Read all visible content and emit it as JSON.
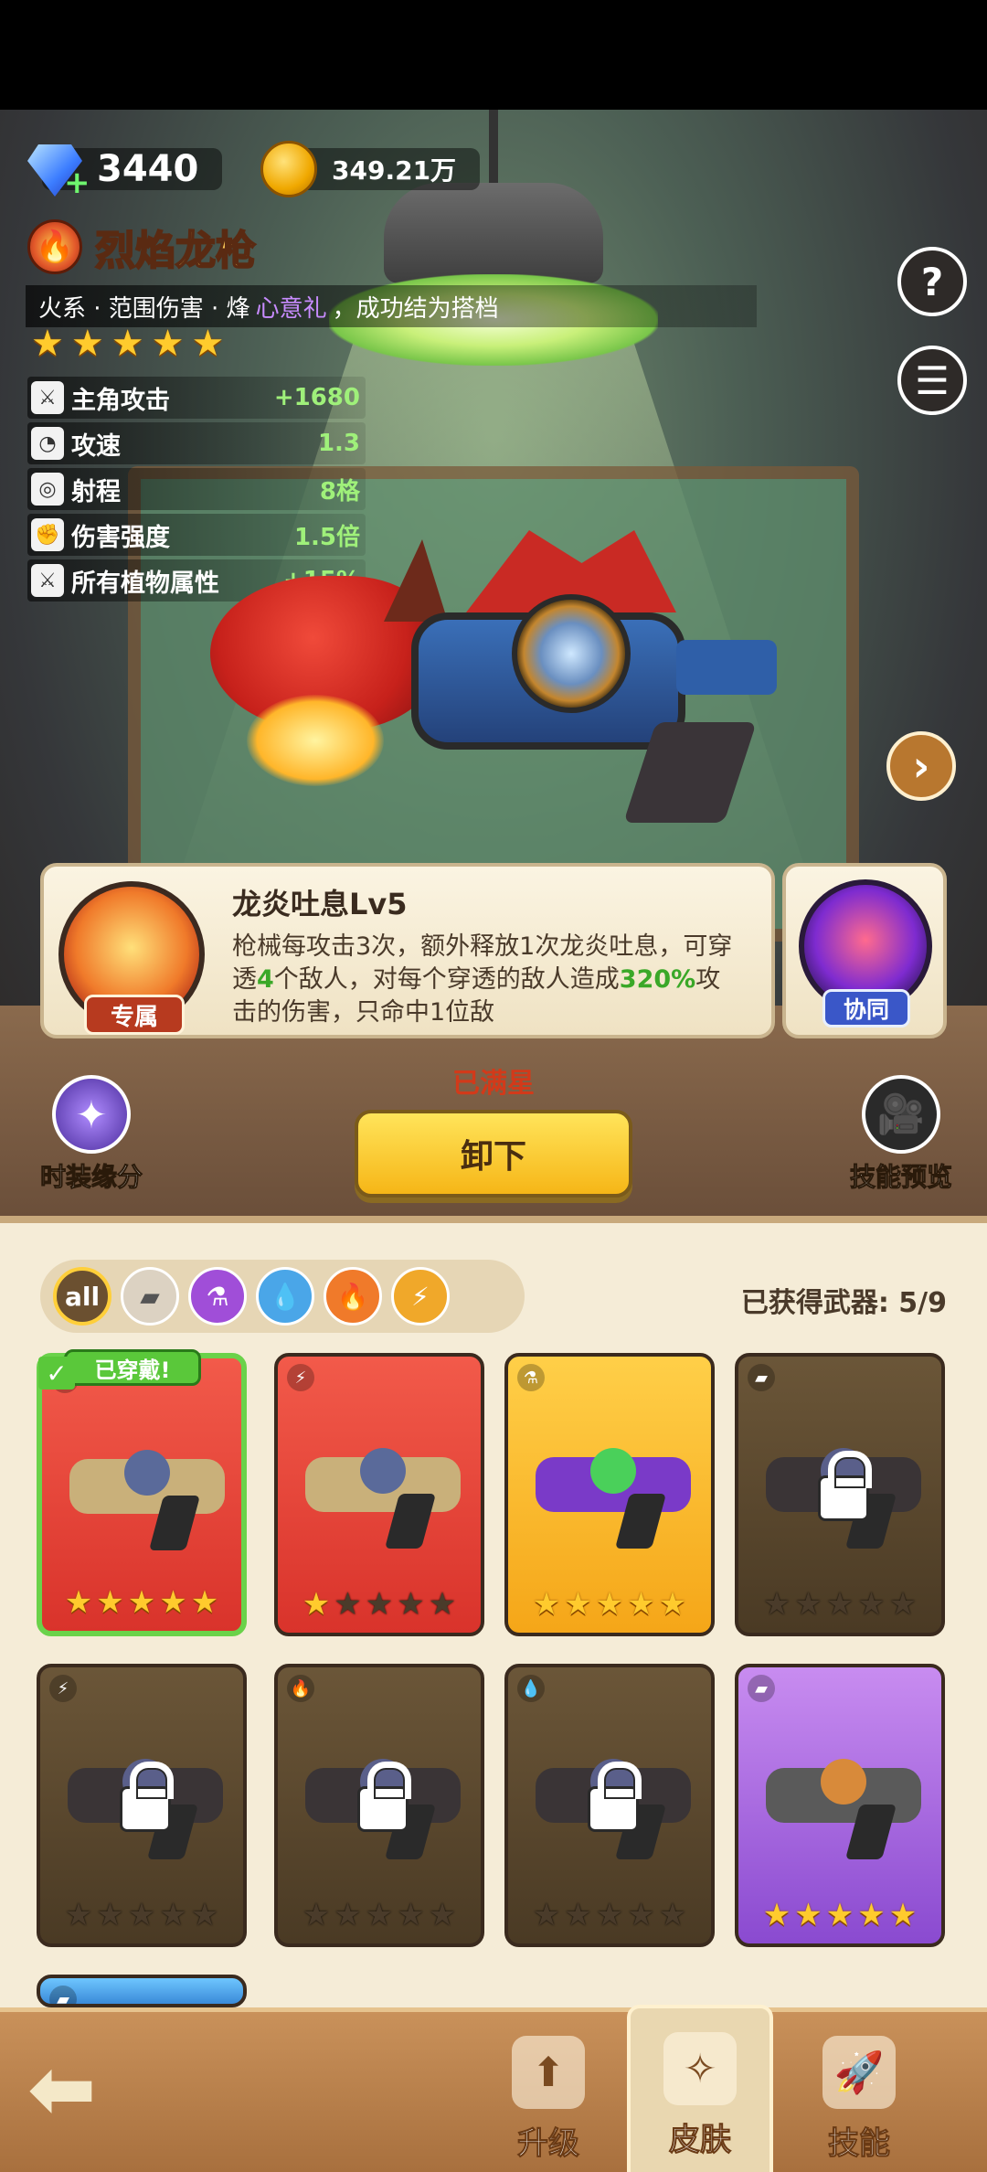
{
  "currency": {
    "gems": "3440",
    "coins": "349.21万"
  },
  "weapon": {
    "name": "烈焰龙枪",
    "tags": "火系 · 范围伤害 · 烽",
    "banner_purple": "心意礼",
    "banner_white": "，成功结为搭档",
    "stars": 5
  },
  "stats": [
    {
      "icon": "sword-icon",
      "label": "主角攻击",
      "value": "+1680"
    },
    {
      "icon": "clock-icon",
      "label": "攻速",
      "value": "1.3"
    },
    {
      "icon": "target-icon",
      "label": "射程",
      "value": "8格"
    },
    {
      "icon": "fist-icon",
      "label": "伤害强度",
      "value": "1.5倍"
    },
    {
      "icon": "sword-icon",
      "label": "所有植物属性",
      "value": "+15%"
    }
  ],
  "skill": {
    "title": "龙炎吐息Lv5",
    "desc_1": "枪械每攻击3次，额外释放1次龙炎吐息，可穿透",
    "desc_num1": "4",
    "desc_2": "个敌人，对每个穿透的敌人造成",
    "desc_num2": "320%",
    "desc_3": "攻击的伤害，只命中1位敌",
    "exclusive_tag": "专属",
    "coop_tag": "协同"
  },
  "actions": {
    "maxed_label": "已满星",
    "unequip_button": "卸下",
    "fashion_label": "时装缘分",
    "preview_label": "技能预览"
  },
  "collection": {
    "filter_all": "all",
    "collected_label": "已获得武器: 5/9",
    "equipped_tag": "已穿戴!",
    "cards": [
      {
        "color": "red",
        "element": "fire",
        "stars": 5,
        "locked": false,
        "equipped": true
      },
      {
        "color": "red",
        "element": "electric",
        "stars": 1,
        "locked": false,
        "equipped": false
      },
      {
        "color": "gold",
        "element": "poison",
        "stars": 5,
        "locked": false,
        "equipped": false
      },
      {
        "color": "locked",
        "element": "physical",
        "stars": 0,
        "locked": true,
        "equipped": false
      },
      {
        "color": "locked",
        "element": "electric",
        "stars": 0,
        "locked": true,
        "equipped": false
      },
      {
        "color": "locked",
        "element": "fire",
        "stars": 0,
        "locked": true,
        "equipped": false
      },
      {
        "color": "locked",
        "element": "water",
        "stars": 0,
        "locked": true,
        "equipped": false
      },
      {
        "color": "purple",
        "element": "physical",
        "stars": 5,
        "locked": false,
        "equipped": false
      },
      {
        "color": "blue",
        "element": "physical",
        "stars": 0,
        "locked": false,
        "equipped": false
      }
    ]
  },
  "nav": {
    "upgrade": "升级",
    "skin": "皮肤",
    "skill": "技能"
  },
  "colors": {
    "accent_gold": "#ffcb2d",
    "equipped_green": "#5ac83a",
    "maxed_red": "#d23a1a"
  }
}
